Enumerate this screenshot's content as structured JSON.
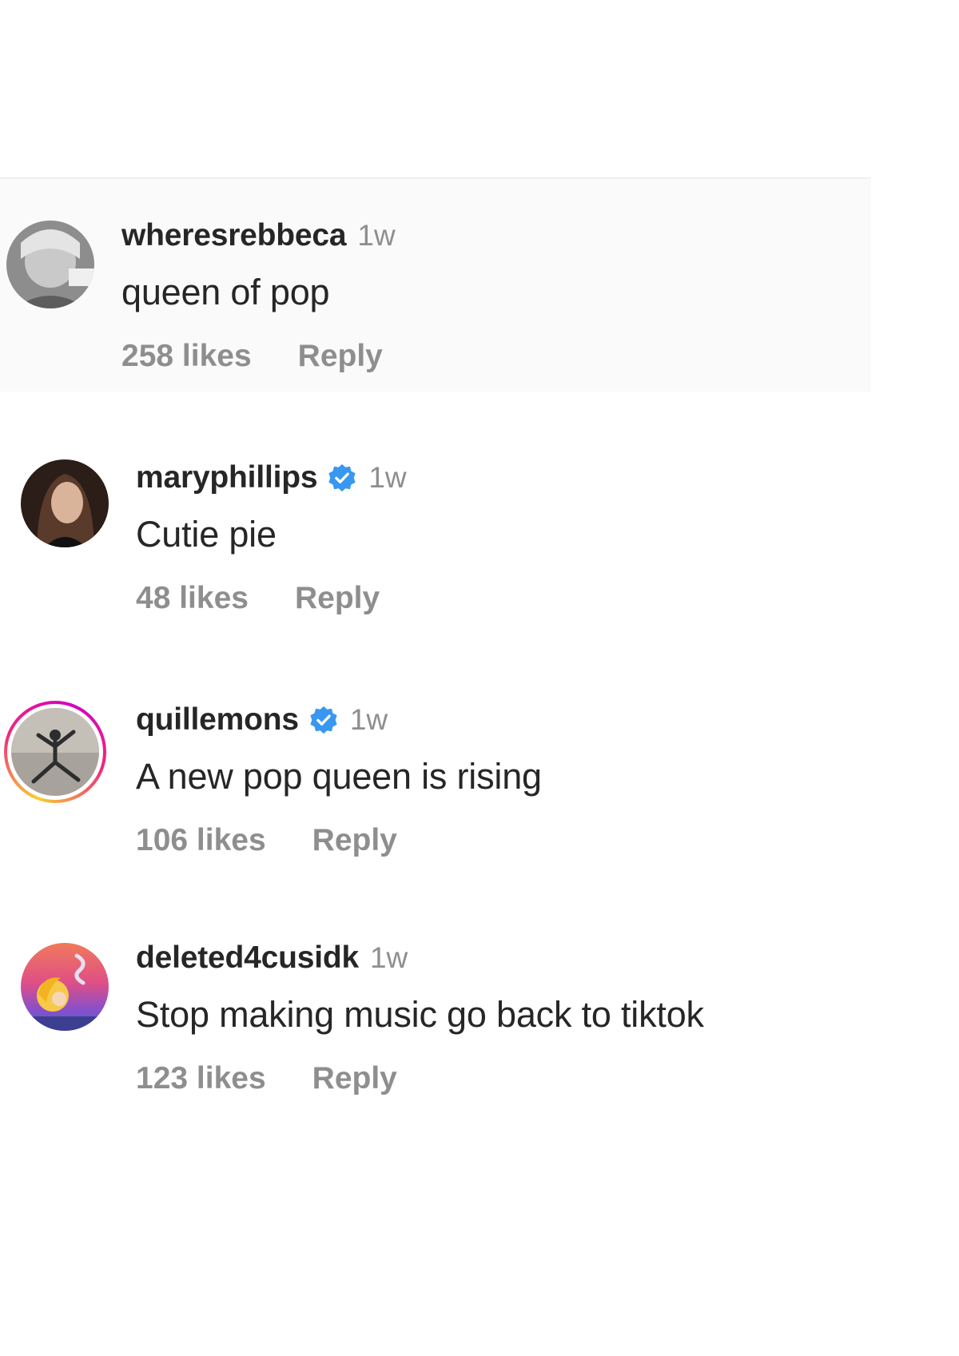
{
  "comments": [
    {
      "username": "wheresrebbeca",
      "verified": false,
      "time": "1w",
      "text": "queen of pop",
      "likes": "258 likes",
      "reply": "Reply",
      "highlighted": true
    },
    {
      "username": "maryphillips",
      "verified": true,
      "time": "1w",
      "text": "Cutie pie",
      "likes": "48 likes",
      "reply": "Reply"
    },
    {
      "username": "quillemons",
      "verified": true,
      "time": "1w",
      "text": "A new pop queen is rising",
      "likes": "106 likes",
      "reply": "Reply",
      "has_story": true
    },
    {
      "username": "deleted4cusidk",
      "verified": false,
      "time": "1w",
      "text": "Stop making music go back to tiktok",
      "likes": "123 likes",
      "reply": "Reply"
    }
  ],
  "colors": {
    "verified_badge": "#3897f0",
    "muted_text": "#8e8e8e",
    "primary_text": "#262626",
    "highlight_bg": "#fafafa"
  },
  "icons": {
    "verified": "verified-badge-icon"
  }
}
